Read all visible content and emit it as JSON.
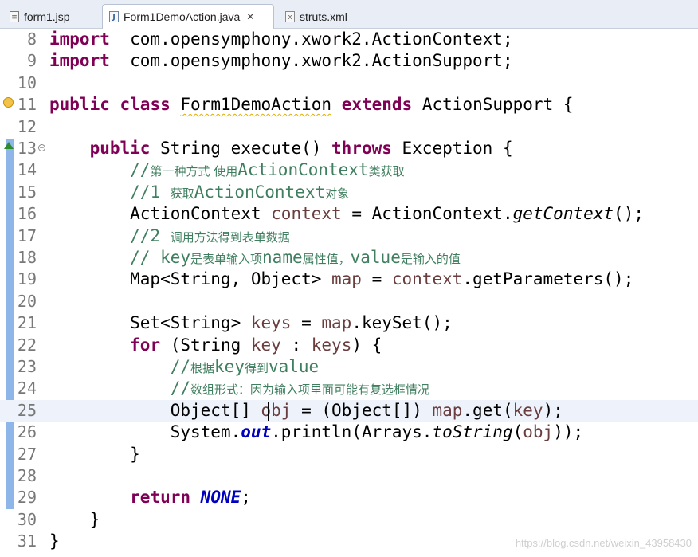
{
  "tabs": [
    {
      "label": "form1.jsp",
      "icon": "jsp-file-icon",
      "active": false
    },
    {
      "label": "Form1DemoAction.java",
      "icon": "java-file-icon",
      "active": true,
      "close": "✕"
    },
    {
      "label": "struts.xml",
      "icon": "xml-file-icon",
      "active": false
    }
  ],
  "lines": [
    {
      "num": "8",
      "parts": [
        [
          "kw",
          "import"
        ],
        [
          "",
          "  com.opensymphony.xwork2.ActionContext;"
        ]
      ]
    },
    {
      "num": "9",
      "parts": [
        [
          "kw",
          "import"
        ],
        [
          "",
          "  com.opensymphony.xwork2.ActionSupport;"
        ]
      ]
    },
    {
      "num": "10",
      "parts": []
    },
    {
      "num": "11",
      "marker": "warning",
      "parts": [
        [
          "kw",
          "public"
        ],
        [
          "",
          " "
        ],
        [
          "kw",
          "class"
        ],
        [
          "",
          " "
        ],
        [
          "squiggle",
          "Form1DemoAction"
        ],
        [
          "",
          " "
        ],
        [
          "kw",
          "extends"
        ],
        [
          "",
          "",
          " ActionSupport {"
        ]
      ]
    },
    {
      "num": "12",
      "parts": []
    },
    {
      "num": "13",
      "marker": "override",
      "fold": true,
      "parts": [
        [
          "",
          "    "
        ],
        [
          "kw",
          "public"
        ],
        [
          "",
          " String execute() "
        ],
        [
          "kw",
          "throws"
        ],
        [
          "",
          " Exception {"
        ]
      ]
    },
    {
      "num": "14",
      "parts": [
        [
          "",
          "        "
        ],
        [
          "comment",
          "//"
        ],
        [
          "comment cjk",
          "第一种方式 使用"
        ],
        [
          "comment",
          "ActionContext"
        ],
        [
          "comment cjk",
          "类获取"
        ]
      ]
    },
    {
      "num": "15",
      "parts": [
        [
          "",
          "        "
        ],
        [
          "comment",
          "//1 "
        ],
        [
          "comment cjk",
          "获取"
        ],
        [
          "comment",
          "ActionContext"
        ],
        [
          "comment cjk",
          "对象"
        ]
      ]
    },
    {
      "num": "16",
      "parts": [
        [
          "",
          "        ActionContext "
        ],
        [
          "var",
          "context"
        ],
        [
          "",
          " = ActionContext."
        ],
        [
          "static",
          "getContext"
        ],
        [
          "",
          "();"
        ]
      ]
    },
    {
      "num": "17",
      "parts": [
        [
          "",
          "        "
        ],
        [
          "comment",
          "//2 "
        ],
        [
          "comment cjk",
          "调用方法得到表单数据"
        ]
      ]
    },
    {
      "num": "18",
      "parts": [
        [
          "",
          "        "
        ],
        [
          "comment",
          "// key"
        ],
        [
          "comment cjk",
          "是表单输入项"
        ],
        [
          "comment",
          "name"
        ],
        [
          "comment cjk",
          "属性值，"
        ],
        [
          "comment",
          "value"
        ],
        [
          "comment cjk",
          "是输入的值"
        ]
      ]
    },
    {
      "num": "19",
      "parts": [
        [
          "",
          "        Map<String, Object> "
        ],
        [
          "var",
          "map"
        ],
        [
          "",
          " = "
        ],
        [
          "var",
          "context"
        ],
        [
          "",
          ".getParameters();"
        ]
      ]
    },
    {
      "num": "20",
      "parts": []
    },
    {
      "num": "21",
      "parts": [
        [
          "",
          "        Set<String> "
        ],
        [
          "var",
          "keys"
        ],
        [
          "",
          " = "
        ],
        [
          "var",
          "map"
        ],
        [
          "",
          ".keySet();"
        ]
      ]
    },
    {
      "num": "22",
      "parts": [
        [
          "",
          "        "
        ],
        [
          "kw",
          "for"
        ],
        [
          "",
          " (String "
        ],
        [
          "var",
          "key"
        ],
        [
          "",
          " : "
        ],
        [
          "var",
          "keys"
        ],
        [
          "",
          ") {"
        ]
      ]
    },
    {
      "num": "23",
      "parts": [
        [
          "",
          "            "
        ],
        [
          "comment",
          "//"
        ],
        [
          "comment cjk",
          "根据"
        ],
        [
          "comment",
          "key"
        ],
        [
          "comment cjk",
          "得到"
        ],
        [
          "comment",
          "value"
        ]
      ]
    },
    {
      "num": "24",
      "parts": [
        [
          "",
          "            "
        ],
        [
          "comment",
          "//"
        ],
        [
          "comment cjk",
          "数组形式：因为输入项里面可能有复选框情况"
        ]
      ]
    },
    {
      "num": "25",
      "current": true,
      "parts": [
        [
          "",
          "            Object[] "
        ],
        [
          "var",
          "obj"
        ],
        [
          "",
          " = (Object[]) "
        ],
        [
          "var",
          "map"
        ],
        [
          "",
          ".get("
        ],
        [
          "var",
          "key"
        ],
        [
          "",
          ");"
        ]
      ]
    },
    {
      "num": "26",
      "parts": [
        [
          "",
          "            System."
        ],
        [
          "field",
          "out"
        ],
        [
          "",
          ".println(Arrays."
        ],
        [
          "static",
          "toString"
        ],
        [
          "",
          "("
        ],
        [
          "var",
          "obj"
        ],
        [
          "",
          "));"
        ]
      ]
    },
    {
      "num": "27",
      "parts": [
        [
          "",
          "        }"
        ]
      ]
    },
    {
      "num": "28",
      "parts": []
    },
    {
      "num": "29",
      "parts": [
        [
          "",
          "        "
        ],
        [
          "kw",
          "return"
        ],
        [
          "",
          " "
        ],
        [
          "field",
          "NONE"
        ],
        [
          "",
          ";"
        ]
      ]
    },
    {
      "num": "30",
      "parts": [
        [
          "",
          "    }"
        ]
      ]
    },
    {
      "num": "31",
      "parts": [
        [
          "",
          "}"
        ]
      ]
    }
  ],
  "watermark": "https://blog.csdn.net/weixin_43958430"
}
